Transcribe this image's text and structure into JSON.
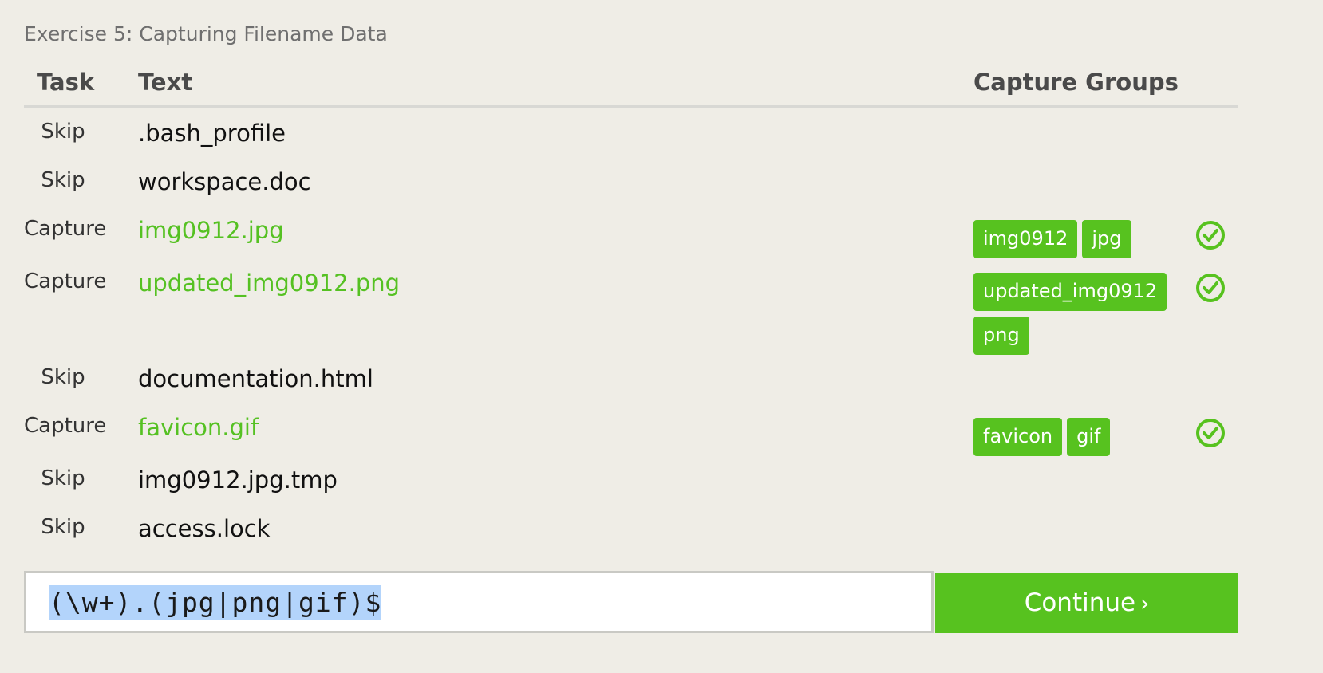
{
  "exercise_title": "Exercise 5: Capturing Filename Data",
  "headers": {
    "task": "Task",
    "text": "Text",
    "capture_groups": "Capture Groups"
  },
  "rows": [
    {
      "task": "Skip",
      "text": ".bash_profile",
      "groups": [],
      "matched": false
    },
    {
      "task": "Skip",
      "text": "workspace.doc",
      "groups": [],
      "matched": false
    },
    {
      "task": "Capture",
      "text": "img0912.jpg",
      "groups": [
        "img0912",
        "jpg"
      ],
      "matched": true
    },
    {
      "task": "Capture",
      "text": "updated_img0912.png",
      "groups": [
        "updated_img0912",
        "png"
      ],
      "matched": true
    },
    {
      "task": "Skip",
      "text": "documentation.html",
      "groups": [],
      "matched": false
    },
    {
      "task": "Capture",
      "text": "favicon.gif",
      "groups": [
        "favicon",
        "gif"
      ],
      "matched": true
    },
    {
      "task": "Skip",
      "text": "img0912.jpg.tmp",
      "groups": [],
      "matched": false
    },
    {
      "task": "Skip",
      "text": "access.lock",
      "groups": [],
      "matched": false
    }
  ],
  "regex_input": {
    "value": "(\\w+).(jpg|png|gif)$"
  },
  "continue_button": {
    "label": "Continue",
    "arrow": "›"
  },
  "colors": {
    "background": "#efede6",
    "accent_green": "#57c21f",
    "match_text_green": "#55c122",
    "selection_blue": "#b3d4fb"
  },
  "icons": {
    "matched": "check-circle-icon"
  }
}
